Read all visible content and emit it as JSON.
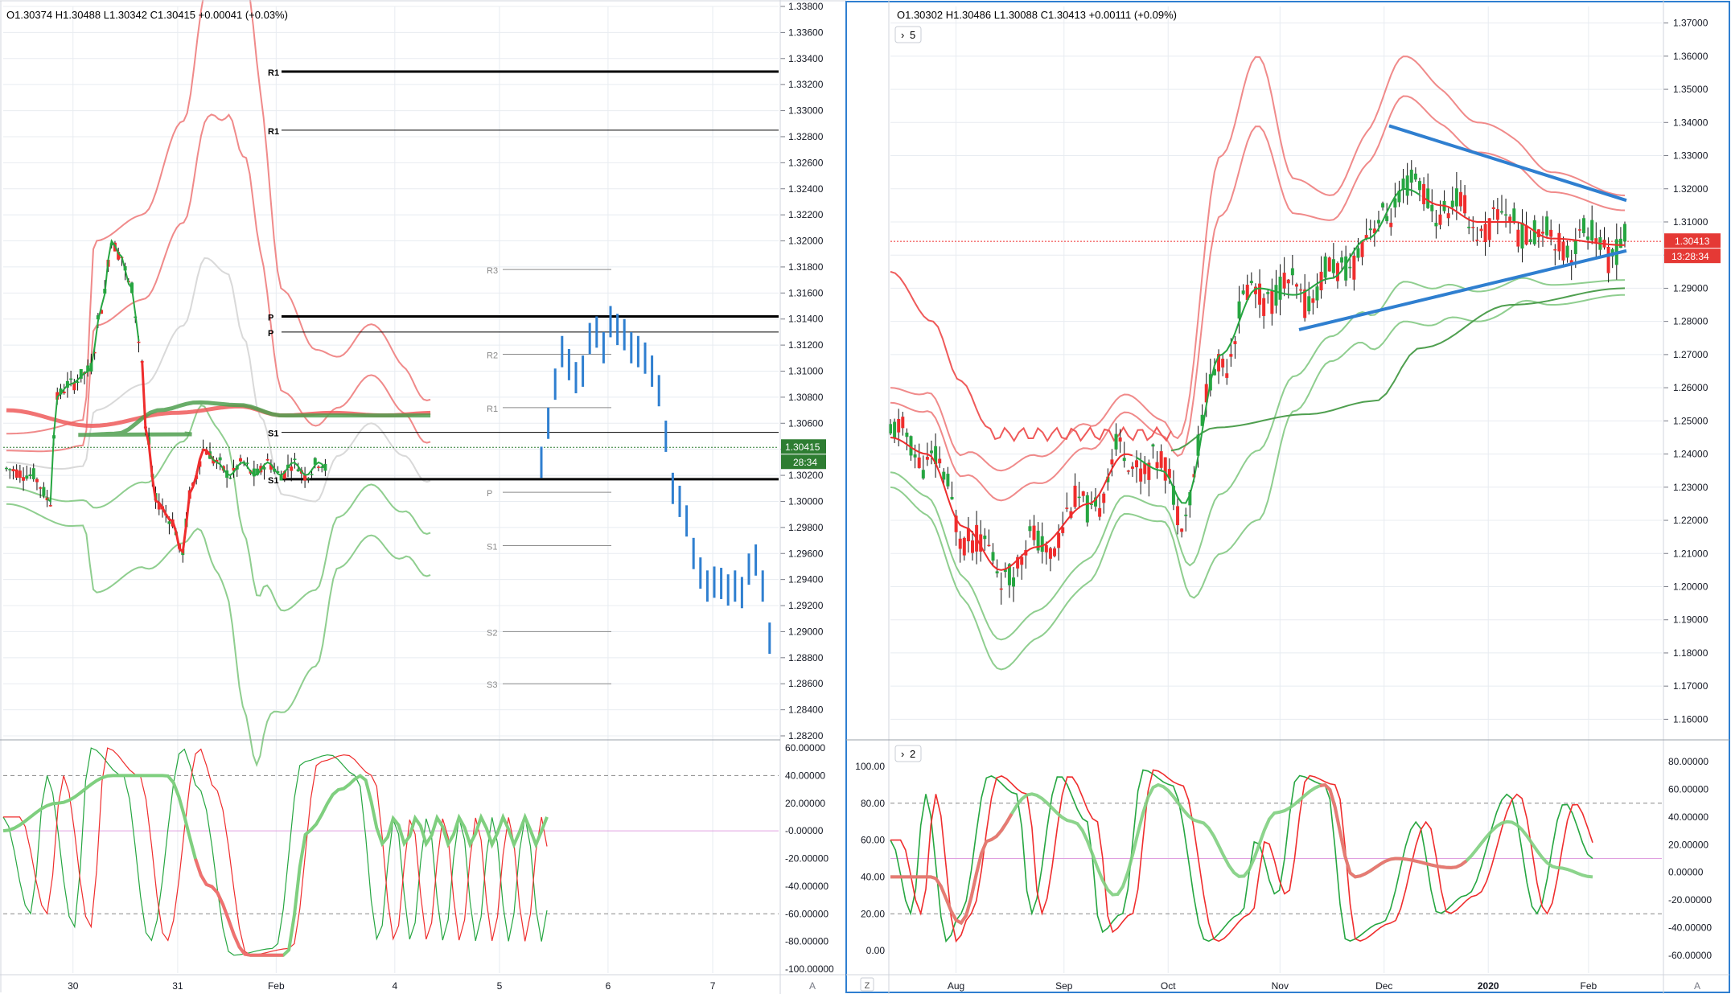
{
  "colors": {
    "up": "#26a641",
    "down": "#ef2d2d",
    "blue": "#2f7fd0",
    "bb_red": "#f08a8a",
    "bb_green": "#8fce8f",
    "ma_red": "#ef5a5a",
    "ma_green": "#4f9f4f",
    "grid": "#e8ecf1",
    "axis_text": "#131722",
    "frame_active": "#2f7fd0"
  },
  "left_panel": {
    "ohlc": {
      "o": "O1.30374",
      "h": "H1.30488",
      "l": "L1.30342",
      "c": "C1.30415",
      "chg": "+0.00041 (+0.03%)"
    },
    "price_axis": {
      "min": 1.282,
      "max": 1.338,
      "labels": [
        "1.33800",
        "1.33600",
        "1.33400",
        "1.33200",
        "1.33000",
        "1.32800",
        "1.32600",
        "1.32400",
        "1.32200",
        "1.32000",
        "1.31800",
        "1.31600",
        "1.31400",
        "1.31200",
        "1.31000",
        "1.30800",
        "1.30600",
        "1.30400",
        "1.30200",
        "1.30000",
        "1.29800",
        "1.29600",
        "1.29400",
        "1.29200",
        "1.29000",
        "1.28800",
        "1.28600",
        "1.28400",
        "1.28200"
      ]
    },
    "last_price": {
      "value": 1.30415,
      "label": "1.30415",
      "countdown": "28:34"
    },
    "date_labels": [
      {
        "text": "30",
        "x": 0.09
      },
      {
        "text": "31",
        "x": 0.225
      },
      {
        "text": "Feb",
        "x": 0.352
      },
      {
        "text": "4",
        "x": 0.505
      },
      {
        "text": "5",
        "x": 0.64
      },
      {
        "text": "6",
        "x": 0.78
      },
      {
        "text": "7",
        "x": 0.915
      }
    ],
    "pivots": [
      {
        "label": "R1",
        "value": 1.333,
        "style": "thick"
      },
      {
        "label": "R1",
        "value": 1.3285,
        "style": "thin"
      },
      {
        "label": "P",
        "value": 1.3142,
        "style": "thick"
      },
      {
        "label": "P",
        "value": 1.313,
        "style": "thin"
      },
      {
        "label": "S1",
        "value": 1.3053,
        "style": "thin"
      },
      {
        "label": "S1",
        "value": 1.3017,
        "style": "thick"
      }
    ],
    "weekly_pivots": [
      {
        "label": "R3",
        "value": 1.3178
      },
      {
        "label": "R2",
        "value": 1.3113
      },
      {
        "label": "R1",
        "value": 1.3072
      },
      {
        "label": "P",
        "value": 1.3007
      },
      {
        "label": "S1",
        "value": 1.2966
      },
      {
        "label": "S2",
        "value": 1.29
      },
      {
        "label": "S3",
        "value": 1.286
      }
    ],
    "osc_axis": {
      "min": -100,
      "max": 60,
      "labels": [
        "60.00000",
        "40.00000",
        "20.00000",
        "-0.00000",
        "-20.00000",
        "-40.00000",
        "-60.00000",
        "-80.00000",
        "-100.00000"
      ],
      "levels": [
        40,
        0,
        -60
      ]
    }
  },
  "right_panel": {
    "ohlc": {
      "o": "O1.30302",
      "h": "H1.30486",
      "l": "L1.30088",
      "c": "C1.30413",
      "chg": "+0.00111 (+0.09%)"
    },
    "price_axis": {
      "min": 1.155,
      "max": 1.375,
      "labels": [
        "1.37000",
        "1.36000",
        "1.35000",
        "1.34000",
        "1.33000",
        "1.32000",
        "1.31000",
        "1.30000",
        "1.29000",
        "1.28000",
        "1.27000",
        "1.26000",
        "1.25000",
        "1.24000",
        "1.23000",
        "1.22000",
        "1.21000",
        "1.20000",
        "1.19000",
        "1.18000",
        "1.17000",
        "1.16000"
      ]
    },
    "last_price": {
      "value": 1.30413,
      "label": "1.30413",
      "countdown": "13:28:34"
    },
    "date_labels": [
      {
        "text": "Aug",
        "x": 0.085
      },
      {
        "text": "Sep",
        "x": 0.225
      },
      {
        "text": "Oct",
        "x": 0.36
      },
      {
        "text": "Nov",
        "x": 0.505
      },
      {
        "text": "Dec",
        "x": 0.64
      },
      {
        "text": "2020",
        "x": 0.775
      },
      {
        "text": "Feb",
        "x": 0.905
      }
    ],
    "study_badge": "5",
    "osc_badge": "2",
    "osc_left_axis": {
      "labels": [
        "100.00",
        "80.00",
        "60.00",
        "40.00",
        "20.00",
        "0.00"
      ]
    },
    "osc_right_axis": {
      "labels": [
        "80.00000",
        "60.00000",
        "40.00000",
        "20.00000",
        "0.00000",
        "-20.00000",
        "-40.00000",
        "-60.00000"
      ]
    }
  },
  "corner_buttons": {
    "auto": "A",
    "zoom": "Z"
  }
}
